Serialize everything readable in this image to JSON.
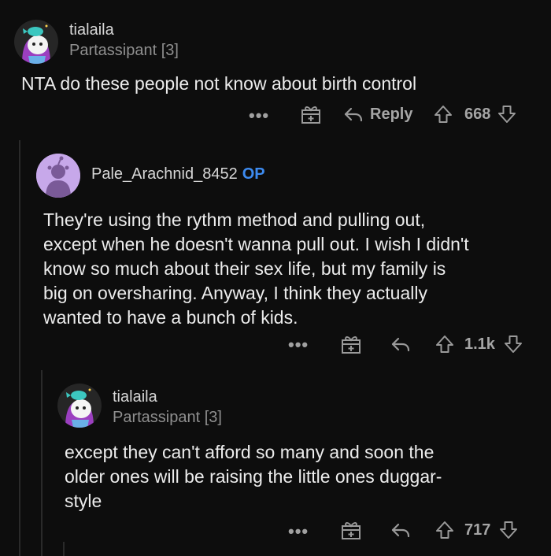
{
  "comments": [
    {
      "username": "tialaila",
      "flair": "Partassipant [3]",
      "body_lines": [
        "NTA do these people not know about birth control"
      ],
      "reply_label": "Reply",
      "score": "668"
    },
    {
      "username": "Pale_Arachnid_8452",
      "op_badge": "OP",
      "body_lines": [
        "They're using the rythm method and pulling out,",
        "except when he doesn't wanna pull out. I wish I didn't",
        "know so much about their sex life, but my family is",
        "big on oversharing. Anyway, I think they actually",
        "wanted to have a bunch of kids."
      ],
      "score": "1.1k"
    },
    {
      "username": "tialaila",
      "flair": "Partassipant [3]",
      "body_lines": [
        "except they can't afford so many and soon the",
        "older ones will be raising the little ones duggar-",
        "style"
      ],
      "score": "717"
    }
  ],
  "icons": {
    "more": "more-options-icon",
    "award": "award-gift-icon",
    "reply": "reply-arrow-icon",
    "upvote": "upvote-arrow-icon",
    "downvote": "downvote-arrow-icon"
  },
  "more_glyph": "•••",
  "colors": {
    "background": "#0d0d0d",
    "op_badge": "#3d8bf0",
    "muted": "#9a9a9a"
  }
}
